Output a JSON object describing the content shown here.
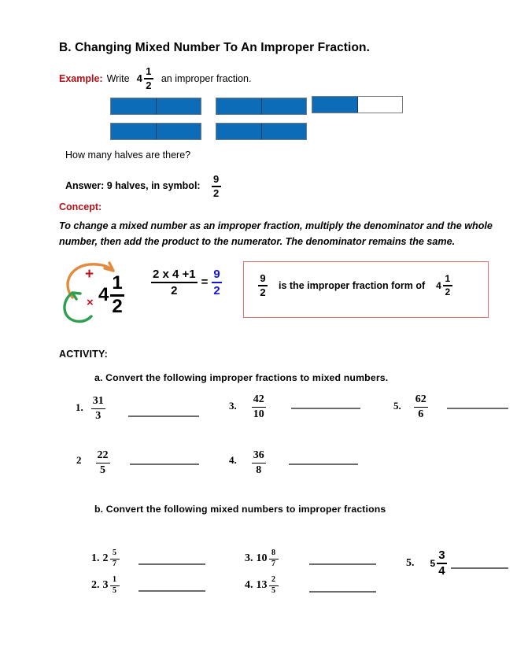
{
  "worksheet": {
    "section_heading": "B. Changing Mixed Number To An Improper Fraction.",
    "example": {
      "label": "Example:",
      "text_before": "Write",
      "mixed_number": {
        "whole": "4",
        "numerator": "1",
        "denominator": "2"
      },
      "text_after": "an improper fraction."
    },
    "diagram": {
      "question": "How many halves are there?",
      "answer_text": "Answer: 9 halves, in symbol:",
      "answer_fraction": {
        "numerator": "9",
        "denominator": "2"
      },
      "bars": [
        {
          "row": 1,
          "col": 1,
          "filled": 2,
          "total": 2
        },
        {
          "row": 1,
          "col": 2,
          "filled": 2,
          "total": 2
        },
        {
          "row": 1,
          "col": 3,
          "filled": 1,
          "total": 2
        },
        {
          "row": 2,
          "col": 1,
          "filled": 2,
          "total": 2
        },
        {
          "row": 2,
          "col": 2,
          "filled": 2,
          "total": 2
        }
      ],
      "fill_color": "#0d6cb8",
      "outline_color": "#7a7a7a"
    },
    "concept": {
      "label": "Concept:",
      "body": "To change a mixed number as an improper fraction, multiply the denominator and the whole number, then add the product to the numerator. The denominator remains the same."
    },
    "worked_example": {
      "mixed": {
        "whole": "4",
        "numerator": "1",
        "denominator": "2"
      },
      "plus_sign": "+",
      "times_sign": "×",
      "plus_arrow_color": "#e08b3e",
      "times_arrow_color": "#2e9e4f",
      "sign_color": "#c1121f",
      "equation": {
        "numerator_expr": "2 x 4 +1",
        "denominator_expr": "2",
        "equals": "=",
        "result": {
          "numerator": "9",
          "denominator": "2"
        },
        "result_color": "#1515d6"
      },
      "callout": {
        "fraction": {
          "numerator": "9",
          "denominator": "2"
        },
        "text": "is the improper fraction form of",
        "mixed": {
          "whole": "4",
          "numerator": "1",
          "denominator": "2"
        },
        "border_color": "#d4726b"
      }
    },
    "activity": {
      "label": "ACTIVITY:",
      "part_a": {
        "instruction": "a.  Convert the following improper fractions to mixed numbers.",
        "items": [
          {
            "number": "1.",
            "numerator": "31",
            "denominator": "3"
          },
          {
            "number": "2",
            "numerator": "22",
            "denominator": "5"
          },
          {
            "number": "3.",
            "numerator": "42",
            "denominator": "10"
          },
          {
            "number": "4.",
            "numerator": "36",
            "denominator": "8"
          },
          {
            "number": "5.",
            "numerator": "62",
            "denominator": "6"
          }
        ]
      },
      "part_b": {
        "instruction": "b.  Convert the following mixed numbers to improper fractions",
        "items": [
          {
            "number": "1.",
            "whole": "2",
            "numerator": "5",
            "denominator": "7"
          },
          {
            "number": "2.",
            "whole": "3",
            "numerator": "1",
            "denominator": "5"
          },
          {
            "number": "3.",
            "whole": "10",
            "numerator": "8",
            "denominator": "7"
          },
          {
            "number": "4.",
            "whole": "13",
            "numerator": "2",
            "denominator": "5"
          },
          {
            "number": "5.",
            "whole": "5",
            "numerator": "3",
            "denominator": "4"
          }
        ]
      }
    }
  }
}
